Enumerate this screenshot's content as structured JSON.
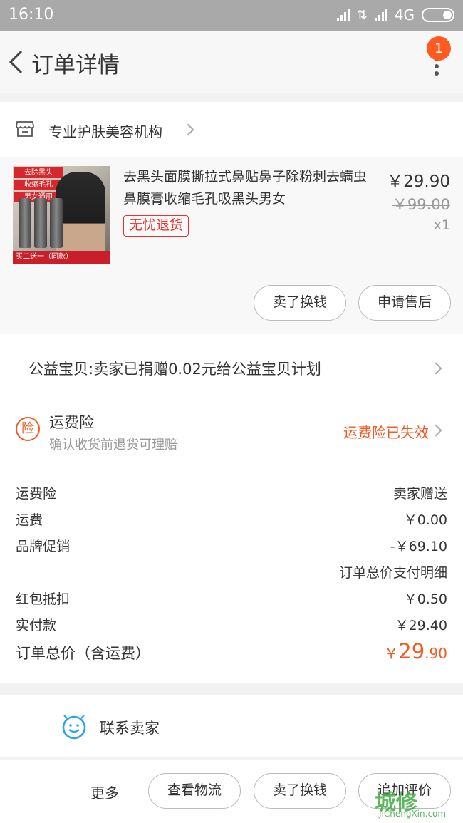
{
  "status_bar": {
    "time": "16:10",
    "network": "4G"
  },
  "header": {
    "title": "订单详情",
    "notification_count": "1"
  },
  "shop": {
    "name": "专业护肤美容机构"
  },
  "product": {
    "title": "去黑头面膜撕拉式鼻贴鼻子除粉刺去螨虫鼻膜膏收缩毛孔吸黑头男女",
    "tag": "无忧退货",
    "price": "￥29.90",
    "original_price": "￥99.00",
    "quantity": "x1",
    "image_text": {
      "tag1": "去除黑头",
      "tag2": "收缩毛孔",
      "tag3": "男女通用",
      "footer": "买二送一（同款）"
    },
    "buttons": {
      "sell": "卖了换钱",
      "after_sale": "申请售后"
    }
  },
  "charity": {
    "text": "公益宝贝:卖家已捐赠0.02元给公益宝贝计划"
  },
  "insurance": {
    "icon": "险",
    "title": "运费险",
    "subtitle": "确认收货前退货可理赔",
    "status": "运费险已失效"
  },
  "fees": {
    "shipping_insurance": {
      "label": "运费险",
      "value": "卖家赠送"
    },
    "shipping": {
      "label": "运费",
      "value": "￥0.00"
    },
    "brand_promo": {
      "label": "品牌促销",
      "value": "-￥69.10"
    },
    "detail_link": "订单总价支付明细",
    "red_packet": {
      "label": "红包抵扣",
      "value": "￥0.50"
    },
    "paid": {
      "label": "实付款",
      "value": "￥29.40"
    },
    "total": {
      "label": "订单总价（含运费）",
      "currency": "￥",
      "integer": "29",
      "decimal": ".90"
    }
  },
  "contact": {
    "label": "联系卖家"
  },
  "actions": {
    "more": "更多",
    "logistics": "查看物流",
    "sell": "卖了换钱",
    "review": "追加评价"
  },
  "watermark": {
    "text": "城修",
    "url": "JiChengXin.com"
  },
  "colors": {
    "accent": "#f15a22",
    "red": "#e8322b",
    "badge": "#ff5a1f"
  }
}
